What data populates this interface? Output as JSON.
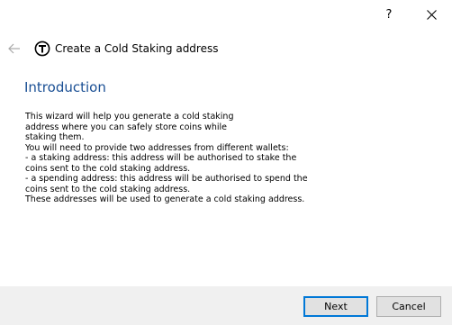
{
  "titlebar": {
    "help_label": "?",
    "help_icon": "question-mark-icon",
    "close_icon": "close-icon"
  },
  "header": {
    "back_icon": "back-arrow-icon",
    "app_icon": "app-logo-icon",
    "title": "Create a Cold Staking address"
  },
  "page": {
    "title": "Introduction",
    "description_lines": [
      "This wizard will help you generate a cold staking",
      "address where you can safely store coins while",
      "staking them.",
      "You will need to provide two addresses from different wallets:",
      "- a staking address: this address will be authorised to stake the",
      "coins sent to the cold staking address.",
      "- a spending address: this address will be authorised to spend the",
      "coins sent to the cold staking address.",
      "These addresses will be used to generate a cold staking address."
    ]
  },
  "footer": {
    "next_label": "Next",
    "cancel_label": "Cancel"
  },
  "colors": {
    "accent": "#1a4f94",
    "footer_bg": "#f0f0f0",
    "button_focus": "#0078d7"
  }
}
